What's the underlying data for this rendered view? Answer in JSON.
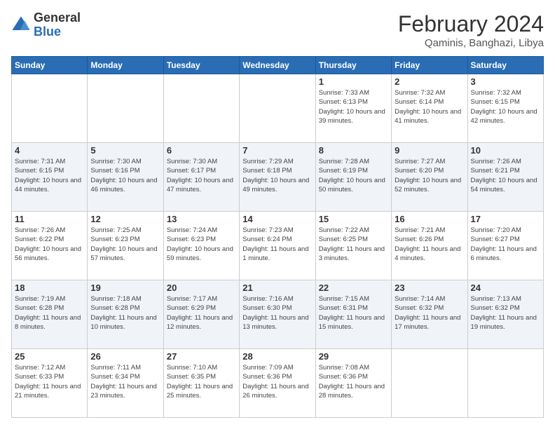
{
  "logo": {
    "general": "General",
    "blue": "Blue"
  },
  "header": {
    "title": "February 2024",
    "subtitle": "Qaminis, Banghazi, Libya"
  },
  "days_of_week": [
    "Sunday",
    "Monday",
    "Tuesday",
    "Wednesday",
    "Thursday",
    "Friday",
    "Saturday"
  ],
  "weeks": [
    [
      {
        "day": "",
        "info": ""
      },
      {
        "day": "",
        "info": ""
      },
      {
        "day": "",
        "info": ""
      },
      {
        "day": "",
        "info": ""
      },
      {
        "day": "1",
        "info": "Sunrise: 7:33 AM\nSunset: 6:13 PM\nDaylight: 10 hours\nand 39 minutes."
      },
      {
        "day": "2",
        "info": "Sunrise: 7:32 AM\nSunset: 6:14 PM\nDaylight: 10 hours\nand 41 minutes."
      },
      {
        "day": "3",
        "info": "Sunrise: 7:32 AM\nSunset: 6:15 PM\nDaylight: 10 hours\nand 42 minutes."
      }
    ],
    [
      {
        "day": "4",
        "info": "Sunrise: 7:31 AM\nSunset: 6:15 PM\nDaylight: 10 hours\nand 44 minutes."
      },
      {
        "day": "5",
        "info": "Sunrise: 7:30 AM\nSunset: 6:16 PM\nDaylight: 10 hours\nand 46 minutes."
      },
      {
        "day": "6",
        "info": "Sunrise: 7:30 AM\nSunset: 6:17 PM\nDaylight: 10 hours\nand 47 minutes."
      },
      {
        "day": "7",
        "info": "Sunrise: 7:29 AM\nSunset: 6:18 PM\nDaylight: 10 hours\nand 49 minutes."
      },
      {
        "day": "8",
        "info": "Sunrise: 7:28 AM\nSunset: 6:19 PM\nDaylight: 10 hours\nand 50 minutes."
      },
      {
        "day": "9",
        "info": "Sunrise: 7:27 AM\nSunset: 6:20 PM\nDaylight: 10 hours\nand 52 minutes."
      },
      {
        "day": "10",
        "info": "Sunrise: 7:26 AM\nSunset: 6:21 PM\nDaylight: 10 hours\nand 54 minutes."
      }
    ],
    [
      {
        "day": "11",
        "info": "Sunrise: 7:26 AM\nSunset: 6:22 PM\nDaylight: 10 hours\nand 56 minutes."
      },
      {
        "day": "12",
        "info": "Sunrise: 7:25 AM\nSunset: 6:23 PM\nDaylight: 10 hours\nand 57 minutes."
      },
      {
        "day": "13",
        "info": "Sunrise: 7:24 AM\nSunset: 6:23 PM\nDaylight: 10 hours\nand 59 minutes."
      },
      {
        "day": "14",
        "info": "Sunrise: 7:23 AM\nSunset: 6:24 PM\nDaylight: 11 hours\nand 1 minute."
      },
      {
        "day": "15",
        "info": "Sunrise: 7:22 AM\nSunset: 6:25 PM\nDaylight: 11 hours\nand 3 minutes."
      },
      {
        "day": "16",
        "info": "Sunrise: 7:21 AM\nSunset: 6:26 PM\nDaylight: 11 hours\nand 4 minutes."
      },
      {
        "day": "17",
        "info": "Sunrise: 7:20 AM\nSunset: 6:27 PM\nDaylight: 11 hours\nand 6 minutes."
      }
    ],
    [
      {
        "day": "18",
        "info": "Sunrise: 7:19 AM\nSunset: 6:28 PM\nDaylight: 11 hours\nand 8 minutes."
      },
      {
        "day": "19",
        "info": "Sunrise: 7:18 AM\nSunset: 6:28 PM\nDaylight: 11 hours\nand 10 minutes."
      },
      {
        "day": "20",
        "info": "Sunrise: 7:17 AM\nSunset: 6:29 PM\nDaylight: 11 hours\nand 12 minutes."
      },
      {
        "day": "21",
        "info": "Sunrise: 7:16 AM\nSunset: 6:30 PM\nDaylight: 11 hours\nand 13 minutes."
      },
      {
        "day": "22",
        "info": "Sunrise: 7:15 AM\nSunset: 6:31 PM\nDaylight: 11 hours\nand 15 minutes."
      },
      {
        "day": "23",
        "info": "Sunrise: 7:14 AM\nSunset: 6:32 PM\nDaylight: 11 hours\nand 17 minutes."
      },
      {
        "day": "24",
        "info": "Sunrise: 7:13 AM\nSunset: 6:32 PM\nDaylight: 11 hours\nand 19 minutes."
      }
    ],
    [
      {
        "day": "25",
        "info": "Sunrise: 7:12 AM\nSunset: 6:33 PM\nDaylight: 11 hours\nand 21 minutes."
      },
      {
        "day": "26",
        "info": "Sunrise: 7:11 AM\nSunset: 6:34 PM\nDaylight: 11 hours\nand 23 minutes."
      },
      {
        "day": "27",
        "info": "Sunrise: 7:10 AM\nSunset: 6:35 PM\nDaylight: 11 hours\nand 25 minutes."
      },
      {
        "day": "28",
        "info": "Sunrise: 7:09 AM\nSunset: 6:36 PM\nDaylight: 11 hours\nand 26 minutes."
      },
      {
        "day": "29",
        "info": "Sunrise: 7:08 AM\nSunset: 6:36 PM\nDaylight: 11 hours\nand 28 minutes."
      },
      {
        "day": "",
        "info": ""
      },
      {
        "day": "",
        "info": ""
      }
    ]
  ]
}
